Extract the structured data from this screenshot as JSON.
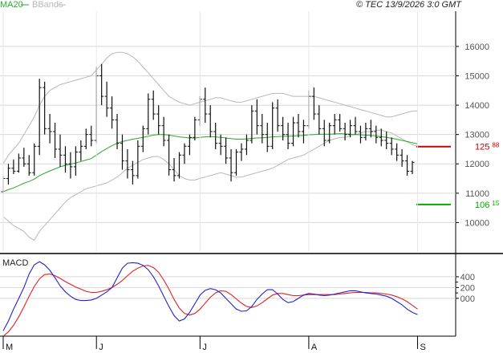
{
  "header": {
    "legend": [
      {
        "label": "MA20",
        "color": "#2aaa2a"
      },
      {
        "label": "BBands",
        "color": "#b8b8b8"
      }
    ],
    "copyright": "© TEC 13/9/2026 3:0 GMT"
  },
  "chart_data": [
    {
      "type": "ohlc",
      "title": "",
      "ylim": [
        9000,
        17200
      ],
      "yticks": [
        10000,
        11000,
        12000,
        13000,
        14000,
        15000,
        16000
      ],
      "ytick_labels": [
        "10000",
        "11000",
        "12000",
        "13000",
        "14000",
        "15000",
        "16000"
      ],
      "month_labels": [
        {
          "label": "M",
          "index": 0
        },
        {
          "label": "J",
          "index": 18
        },
        {
          "label": "J",
          "index": 38
        },
        {
          "label": "A",
          "index": 59
        },
        {
          "label": "S",
          "index": 80
        }
      ],
      "grid": true,
      "candles": [
        [
          11050,
          11600,
          11000,
          11500
        ],
        [
          11500,
          12000,
          11300,
          11850
        ],
        [
          11850,
          12150,
          11650,
          11750
        ],
        [
          11750,
          12350,
          11700,
          12200
        ],
        [
          12200,
          12550,
          11900,
          12000
        ],
        [
          12000,
          12300,
          11600,
          11700
        ],
        [
          11700,
          12700,
          11600,
          12600
        ],
        [
          12600,
          14900,
          12300,
          14600
        ],
        [
          14600,
          14800,
          13000,
          13200
        ],
        [
          13200,
          13700,
          12700,
          13100
        ],
        [
          13100,
          13400,
          12200,
          12500
        ],
        [
          12500,
          13000,
          11900,
          12300
        ],
        [
          12300,
          12600,
          11700,
          12000
        ],
        [
          12000,
          12400,
          11500,
          11900
        ],
        [
          11900,
          12600,
          11600,
          12400
        ],
        [
          12400,
          12800,
          12100,
          12600
        ],
        [
          12600,
          13200,
          12500,
          13000
        ],
        [
          13000,
          13300,
          12600,
          12800
        ],
        [
          12800,
          15300,
          12700,
          15000
        ],
        [
          15000,
          15400,
          14000,
          14300
        ],
        [
          14300,
          14800,
          13600,
          13900
        ],
        [
          13900,
          14300,
          13200,
          13500
        ],
        [
          13500,
          13700,
          12500,
          12700
        ],
        [
          12700,
          13000,
          11800,
          12100
        ],
        [
          12100,
          12500,
          11500,
          11800
        ],
        [
          11800,
          12100,
          11300,
          11600
        ],
        [
          11600,
          12800,
          11500,
          12600
        ],
        [
          12600,
          13300,
          12400,
          13200
        ],
        [
          13200,
          14400,
          13000,
          14200
        ],
        [
          14200,
          14500,
          13500,
          13700
        ],
        [
          13700,
          14000,
          13000,
          13300
        ],
        [
          13300,
          13600,
          12600,
          12800
        ],
        [
          12800,
          13000,
          11600,
          11800
        ],
        [
          11800,
          12200,
          11400,
          11600
        ],
        [
          11600,
          12400,
          11500,
          12300
        ],
        [
          12300,
          12700,
          12000,
          12600
        ],
        [
          12600,
          13000,
          12300,
          12900
        ],
        [
          12900,
          13600,
          12800,
          13500
        ],
        [
          13500,
          14300,
          13300,
          14200
        ],
        [
          14200,
          14600,
          13400,
          13700
        ],
        [
          13700,
          14000,
          12900,
          13100
        ],
        [
          13100,
          13400,
          12500,
          12700
        ],
        [
          12700,
          13000,
          12300,
          12600
        ],
        [
          12600,
          12900,
          12000,
          12200
        ],
        [
          12200,
          12500,
          11400,
          11700
        ],
        [
          11700,
          12500,
          11600,
          12400
        ],
        [
          12400,
          12700,
          12100,
          12500
        ],
        [
          12500,
          13000,
          12300,
          12800
        ],
        [
          12800,
          14000,
          12700,
          13800
        ],
        [
          13800,
          14200,
          13000,
          13300
        ],
        [
          13300,
          13700,
          12700,
          13000
        ],
        [
          13000,
          13400,
          12400,
          12600
        ],
        [
          12600,
          14100,
          12500,
          13900
        ],
        [
          13900,
          14200,
          13100,
          13300
        ],
        [
          13300,
          13600,
          12800,
          13000
        ],
        [
          13000,
          13400,
          12500,
          12700
        ],
        [
          12700,
          13600,
          12600,
          13400
        ],
        [
          13400,
          13700,
          12900,
          13100
        ],
        [
          13100,
          13500,
          12700,
          13300
        ],
        [
          13300,
          14500,
          13200,
          14300
        ],
        [
          14300,
          14600,
          13500,
          13700
        ],
        [
          13700,
          14000,
          13000,
          13200
        ],
        [
          13200,
          13500,
          12600,
          12800
        ],
        [
          12800,
          13400,
          12700,
          13300
        ],
        [
          13300,
          13700,
          13000,
          13500
        ],
        [
          13500,
          13700,
          13100,
          13200
        ],
        [
          13200,
          13400,
          12800,
          13000
        ],
        [
          13000,
          13500,
          12900,
          13300
        ],
        [
          13300,
          13600,
          13000,
          13100
        ],
        [
          13100,
          13300,
          12700,
          12900
        ],
        [
          12900,
          13400,
          12800,
          13200
        ],
        [
          13200,
          13500,
          12900,
          13100
        ],
        [
          13100,
          13300,
          12700,
          12900
        ],
        [
          12900,
          13200,
          12600,
          12800
        ],
        [
          12800,
          13100,
          12500,
          12700
        ],
        [
          12700,
          12900,
          12300,
          12500
        ],
        [
          12500,
          12700,
          12100,
          12300
        ],
        [
          12300,
          12500,
          11900,
          12100
        ],
        [
          12100,
          12300,
          11600,
          11750
        ],
        [
          11750,
          12100,
          11650,
          12050
        ]
      ],
      "series": [
        {
          "name": "MA20",
          "color": "#2aaa2a",
          "values": [
            11050,
            11120,
            11180,
            11260,
            11340,
            11400,
            11480,
            11600,
            11680,
            11760,
            11830,
            11900,
            11950,
            11990,
            12030,
            12080,
            12130,
            12180,
            12300,
            12420,
            12520,
            12620,
            12700,
            12760,
            12800,
            12840,
            12870,
            12900,
            12940,
            12980,
            13000,
            13000,
            12980,
            12950,
            12920,
            12900,
            12880,
            12880,
            12900,
            12920,
            12930,
            12920,
            12900,
            12880,
            12860,
            12840,
            12840,
            12850,
            12870,
            12880,
            12890,
            12900,
            12920,
            12930,
            12940,
            12940,
            12950,
            12960,
            12970,
            12990,
            13000,
            13010,
            13010,
            13010,
            13020,
            13030,
            13020,
            13010,
            13000,
            12990,
            12980,
            12970,
            12950,
            12930,
            12900,
            12870,
            12840,
            12800,
            12760,
            12720,
            12680
          ]
        },
        {
          "name": "BBands upper",
          "color": "#b8b8b8",
          "values": [
            12000,
            12300,
            12500,
            12700,
            13000,
            13300,
            13600,
            14000,
            14300,
            14500,
            14600,
            14700,
            14750,
            14800,
            14850,
            14900,
            14950,
            15000,
            15200,
            15400,
            15600,
            15750,
            15800,
            15800,
            15750,
            15650,
            15500,
            15300,
            15100,
            14900,
            14700,
            14500,
            14300,
            14200,
            14100,
            14050,
            14000,
            14050,
            14100,
            14150,
            14200,
            14250,
            14250,
            14200,
            14150,
            14100,
            14100,
            14150,
            14200,
            14250,
            14300,
            14350,
            14400,
            14400,
            14400,
            14350,
            14300,
            14300,
            14300,
            14300,
            14300,
            14250,
            14200,
            14150,
            14100,
            14050,
            14000,
            13950,
            13900,
            13850,
            13800,
            13750,
            13700,
            13650,
            13600,
            13600,
            13650,
            13700,
            13750,
            13800,
            13800
          ]
        },
        {
          "name": "BBands lower",
          "color": "#b8b8b8",
          "values": [
            10200,
            10050,
            9900,
            9800,
            9700,
            9500,
            9400,
            9700,
            9900,
            10100,
            10300,
            10500,
            10700,
            10850,
            10950,
            11050,
            11150,
            11200,
            11250,
            11300,
            11350,
            11450,
            11550,
            11700,
            11850,
            11950,
            12050,
            12150,
            12200,
            12250,
            12250,
            12150,
            12000,
            11800,
            11600,
            11500,
            11450,
            11450,
            11500,
            11550,
            11600,
            11650,
            11700,
            11650,
            11600,
            11550,
            11550,
            11600,
            11650,
            11700,
            11750,
            11800,
            11850,
            11950,
            12050,
            12150,
            12200,
            12250,
            12300,
            12400,
            12500,
            12600,
            12700,
            12800,
            12850,
            12900,
            12900,
            12950,
            13000,
            13050,
            13100,
            13100,
            13150,
            13150,
            13100,
            13050,
            12950,
            12850,
            12750,
            12650,
            12600
          ]
        }
      ],
      "reference_levels": [
        {
          "label": "125.88",
          "value": 12588,
          "color": "#cc0000"
        },
        {
          "label": "106.15",
          "value": 10615,
          "color": "#00aa00"
        }
      ]
    },
    {
      "type": "line",
      "title": "MACD",
      "ylim": [
        -700,
        800
      ],
      "yticks": [
        0,
        200,
        400
      ],
      "ytick_labels": [
        "000",
        "200",
        "400"
      ],
      "series": [
        {
          "name": "MACD",
          "color": "#2222cc",
          "values": [
            -600,
            -420,
            -200,
            0,
            200,
            450,
            620,
            680,
            620,
            520,
            380,
            230,
            120,
            40,
            -20,
            -40,
            -40,
            -30,
            0,
            60,
            120,
            200,
            380,
            560,
            650,
            660,
            650,
            610,
            530,
            400,
            230,
            40,
            -150,
            -320,
            -420,
            -380,
            -260,
            -100,
            60,
            150,
            180,
            160,
            100,
            0,
            -100,
            -200,
            -240,
            -230,
            -150,
            -20,
            80,
            160,
            160,
            80,
            -20,
            -80,
            -60,
            0,
            60,
            90,
            80,
            60,
            50,
            60,
            80,
            100,
            120,
            140,
            140,
            120,
            100,
            90,
            80,
            60,
            40,
            0,
            -60,
            -120,
            -200,
            -260,
            -300
          ]
        },
        {
          "name": "Signal",
          "color": "#dd2222",
          "values": [
            -700,
            -620,
            -500,
            -340,
            -160,
            40,
            220,
            360,
            440,
            450,
            420,
            370,
            310,
            260,
            210,
            170,
            130,
            110,
            110,
            130,
            160,
            200,
            260,
            330,
            420,
            500,
            560,
            600,
            610,
            570,
            480,
            340,
            170,
            -20,
            -180,
            -280,
            -310,
            -280,
            -200,
            -90,
            20,
            100,
            140,
            130,
            70,
            -10,
            -90,
            -150,
            -170,
            -140,
            -80,
            -10,
            60,
            90,
            90,
            70,
            50,
            50,
            60,
            70,
            70,
            70,
            70,
            70,
            70,
            80,
            90,
            100,
            110,
            110,
            110,
            100,
            100,
            90,
            80,
            60,
            30,
            -10,
            -60,
            -130,
            -200
          ]
        }
      ]
    }
  ]
}
